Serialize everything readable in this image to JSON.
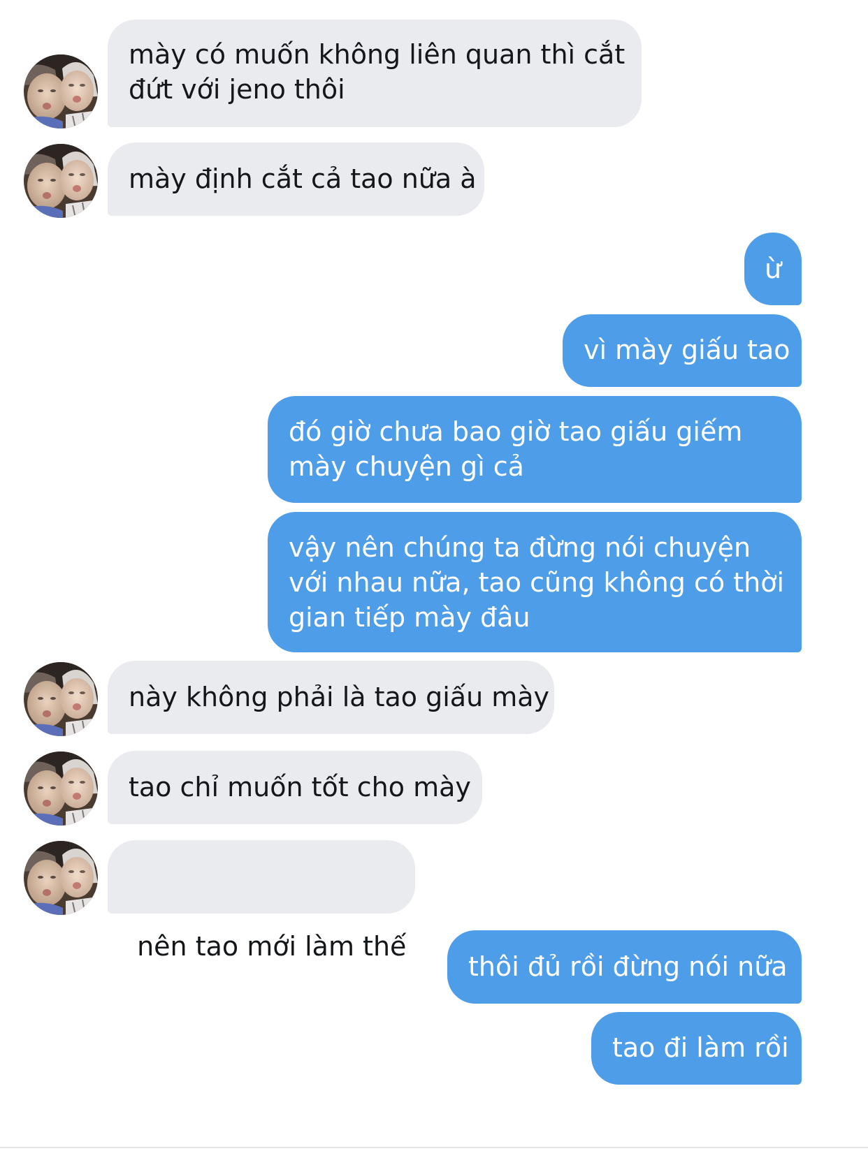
{
  "conversation": {
    "messages": [
      {
        "sender": "them",
        "lines": [
          "mày có muốn không liên quan thì cắt",
          "đứt với jeno thôi"
        ]
      },
      {
        "sender": "them",
        "lines": [
          "mày định cắt cả tao nữa à"
        ]
      },
      {
        "sender": "me",
        "lines": [
          "ừ"
        ]
      },
      {
        "sender": "me",
        "lines": [
          "vì mày giấu tao"
        ]
      },
      {
        "sender": "me",
        "lines": [
          "đó giờ chưa bao giờ tao giấu giếm",
          "mày chuyện gì cả"
        ]
      },
      {
        "sender": "me",
        "lines": [
          "vậy nên chúng ta đừng nói chuyện",
          "với nhau nữa, tao cũng không có thời",
          "gian tiếp mày đâu"
        ]
      },
      {
        "sender": "them",
        "lines": [
          "này không phải là tao giấu mày"
        ]
      },
      {
        "sender": "them",
        "lines": [
          "tao chỉ muốn tốt cho mày"
        ]
      },
      {
        "sender": "them",
        "lines": [
          " nên tao mới làm thế"
        ]
      },
      {
        "sender": "me",
        "lines": [
          "thôi đủ rồi đừng nói nữa"
        ]
      },
      {
        "sender": "me",
        "lines": [
          "tao đi làm rồi"
        ]
      }
    ]
  },
  "colors": {
    "incoming_bubble": "#eaebef",
    "outgoing_bubble": "#4d9de8",
    "outgoing_text": "#ffffff",
    "incoming_text": "#14171a"
  }
}
